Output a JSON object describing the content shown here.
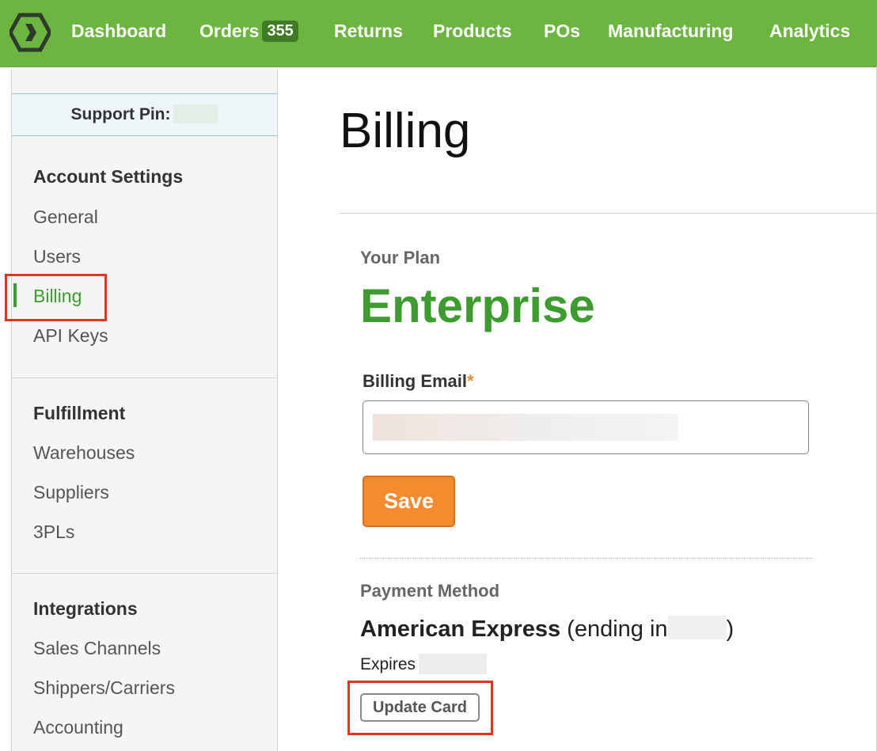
{
  "nav": {
    "items": [
      {
        "label": "Dashboard"
      },
      {
        "label": "Orders",
        "badge": "355"
      },
      {
        "label": "Returns"
      },
      {
        "label": "Products"
      },
      {
        "label": "POs"
      },
      {
        "label": "Manufacturing"
      },
      {
        "label": "Analytics"
      }
    ]
  },
  "sidebar": {
    "support_label": "Support Pin:",
    "sections": [
      {
        "title": "Account Settings",
        "items": [
          "General",
          "Users",
          "Billing",
          "API Keys"
        ]
      },
      {
        "title": "Fulfillment",
        "items": [
          "Warehouses",
          "Suppliers",
          "3PLs"
        ]
      },
      {
        "title": "Integrations",
        "items": [
          "Sales Channels",
          "Shippers/Carriers",
          "Accounting"
        ]
      }
    ],
    "active_item": "Billing"
  },
  "main": {
    "title": "Billing",
    "plan_label": "Your Plan",
    "plan_name": "Enterprise",
    "email_label": "Billing Email",
    "required_mark": "*",
    "save_label": "Save",
    "payment_label": "Payment Method",
    "card_brand": "American Express",
    "card_prefix": "(ending in",
    "card_suffix": ")",
    "expires_label": "Expires",
    "update_card_label": "Update Card"
  },
  "colors": {
    "brand_green": "#6bb540",
    "active_green": "#3d9b2f",
    "save_orange": "#f58a2e",
    "highlight_red": "#e8331c"
  }
}
